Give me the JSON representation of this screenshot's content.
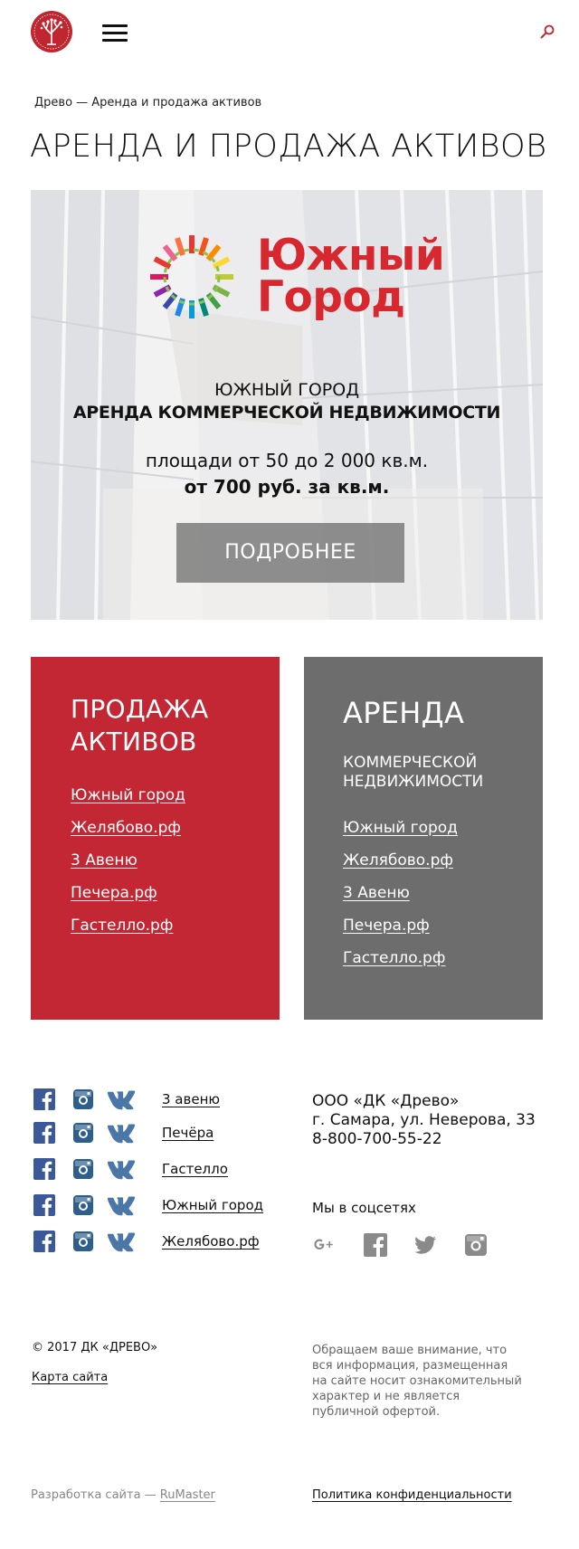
{
  "header": {
    "logo_icon": "tree-logo-icon",
    "menu_icon": "hamburger-menu-icon",
    "search_icon": "search-icon",
    "accent_color": "#c0262f"
  },
  "breadcrumb": "Древо — Аренда и продажа активов",
  "page_title": "АРЕНДА И ПРОДАЖА АКТИВОВ",
  "banner": {
    "brand_line1": "Южный",
    "brand_line2": "Город",
    "subtitle1": "ЮЖНЫЙ ГОРОД",
    "subtitle2": "АРЕНДА КОММЕРЧЕСКОЙ НЕДВИЖИМОСТИ",
    "area": "площади от 50 до 2 000 кв.м.",
    "price": "от 700 руб. за кв.м.",
    "button": "ПОДРОБНЕЕ",
    "brand_color": "#d8282f"
  },
  "sale_panel": {
    "title_line1": "ПРОДАЖА",
    "title_line2": "АКТИВОВ",
    "color": "#c22733",
    "links": [
      "Южный город",
      "Желябово.рф",
      "3 Авеню",
      "Печера.рф",
      "Гастелло.рф"
    ]
  },
  "rent_panel": {
    "title": "АРЕНДА",
    "subtitle_line1": "КОММЕРЧЕСКОЙ",
    "subtitle_line2": "НЕДВИЖИМОСТИ",
    "color": "#6d6d6d",
    "links": [
      "Южный город",
      "Желябово.рф",
      "3 Авеню",
      "Печера.рф",
      "Гастелло.рф"
    ]
  },
  "footer": {
    "social_projects": [
      {
        "label": "3 авеню",
        "icons": [
          "facebook-icon",
          "instagram-icon",
          "vk-icon"
        ]
      },
      {
        "label": "Печёра",
        "icons": [
          "facebook-icon",
          "instagram-icon",
          "vk-icon"
        ]
      },
      {
        "label": "Гастелло",
        "icons": [
          "facebook-icon",
          "instagram-icon",
          "vk-icon"
        ]
      },
      {
        "label": "Южный город",
        "icons": [
          "facebook-icon",
          "instagram-icon",
          "vk-icon"
        ]
      },
      {
        "label": "Желябово.рф",
        "icons": [
          "facebook-icon",
          "instagram-icon",
          "vk-icon"
        ]
      }
    ],
    "company": "ООО «ДК «Древо»",
    "address": "г. Самара, ул. Неверова, 33",
    "phone": "8-800-700-55-22",
    "social_label": "Мы в соцсетях",
    "company_socials": [
      "google-plus-icon",
      "facebook-icon",
      "twitter-icon",
      "instagram-icon"
    ],
    "copyright": "© 2017 ДК «ДРЕВО»",
    "sitemap": "Карта сайта",
    "notice": "Обращаем ваше внимание, что вся информация, размещенная на сайте носит ознакомительный характер и не является публичной офертой.",
    "dev_prefix": "Разработка сайта — ",
    "dev_link": "RuMaster",
    "privacy": "Политика конфиденциальности"
  }
}
